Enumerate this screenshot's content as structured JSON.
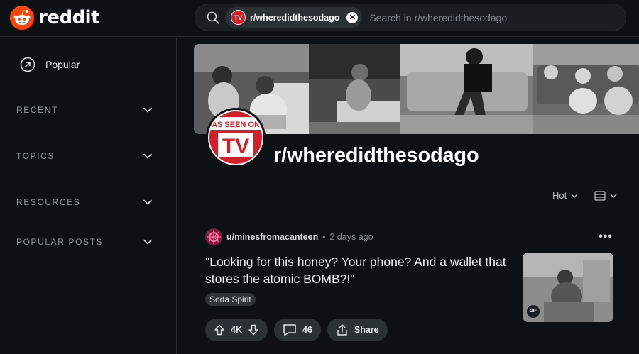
{
  "header": {
    "logo_text": "reddit",
    "search": {
      "chip_label": "r/wheredidthesodago",
      "chip_avatar_text": "TV",
      "placeholder": "Search in r/wheredidthesodago"
    }
  },
  "sidebar": {
    "popular_label": "Popular",
    "sections": [
      {
        "label": "RECENT"
      },
      {
        "label": "TOPICS"
      },
      {
        "label": "RESOURCES"
      },
      {
        "label": "POPULAR POSTS"
      }
    ]
  },
  "community": {
    "name": "r/wheredidthesodago",
    "avatar_text_top": "AS SEEN ON",
    "avatar_text_main": "TV"
  },
  "feed": {
    "sort_label": "Hot"
  },
  "post": {
    "username": "u/minesfromacanteen",
    "separator": "•",
    "timestamp": "2 days ago",
    "more_label": "•••",
    "title": "\"Looking for this honey? Your phone? And a wallet that stores the atomic BOMB?!\"",
    "flair": "Soda Spirit",
    "gif_badge": "GIF",
    "upvotes": "4K",
    "comments": "46",
    "share_label": "Share"
  },
  "colors": {
    "background": "#0e1113",
    "reddit_orange": "#ff4500",
    "tv_red": "#d41f2b",
    "pill": "#2a3236"
  }
}
